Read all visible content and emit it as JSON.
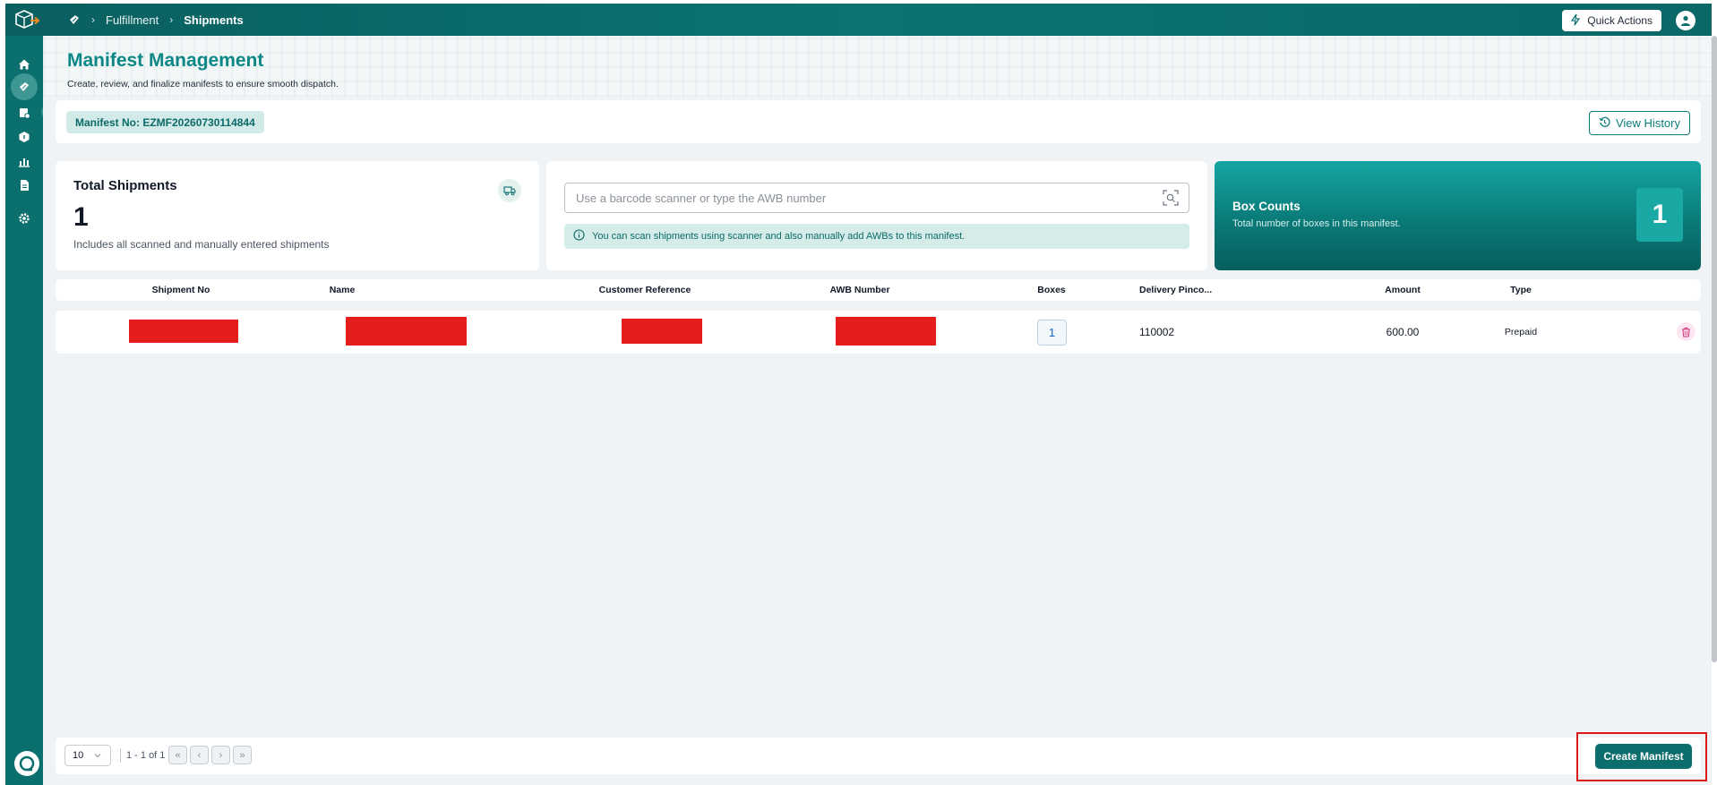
{
  "topbar": {
    "breadcrumbs": [
      "Fulfillment",
      "Shipments"
    ],
    "quick_actions_label": "Quick Actions"
  },
  "header": {
    "title": "Manifest Management",
    "subtitle": "Create, review, and finalize manifests to ensure smooth dispatch."
  },
  "manifest": {
    "number_label": "Manifest No: EZMF20260730114844",
    "view_history_label": "View History"
  },
  "total_shipments": {
    "title": "Total Shipments",
    "value": "1",
    "description": "Includes all scanned and manually entered shipments"
  },
  "scan": {
    "placeholder": "Use a barcode scanner or type the AWB number",
    "value": "",
    "info": "You can scan shipments using scanner and also manually add AWBs to this manifest."
  },
  "box_counts": {
    "title": "Box Counts",
    "subtitle": "Total number of boxes in this manifest.",
    "value": "1"
  },
  "table": {
    "columns": [
      "Shipment No",
      "Name",
      "Customer Reference",
      "AWB Number",
      "Boxes",
      "Delivery Pinco...",
      "Amount",
      "Type"
    ],
    "rows": [
      {
        "boxes": "1",
        "delivery_pincode": "110002",
        "amount": "600.00",
        "type": "Prepaid"
      }
    ]
  },
  "pagination": {
    "page_size": "10",
    "range": "1 - 1 of 1"
  },
  "actions": {
    "create_manifest_label": "Create Manifest"
  },
  "colors": {
    "brand_teal": "#0b6f6e",
    "title_teal": "#0c8786",
    "redaction": "#e51d1d",
    "highlight": "#d9181a"
  }
}
